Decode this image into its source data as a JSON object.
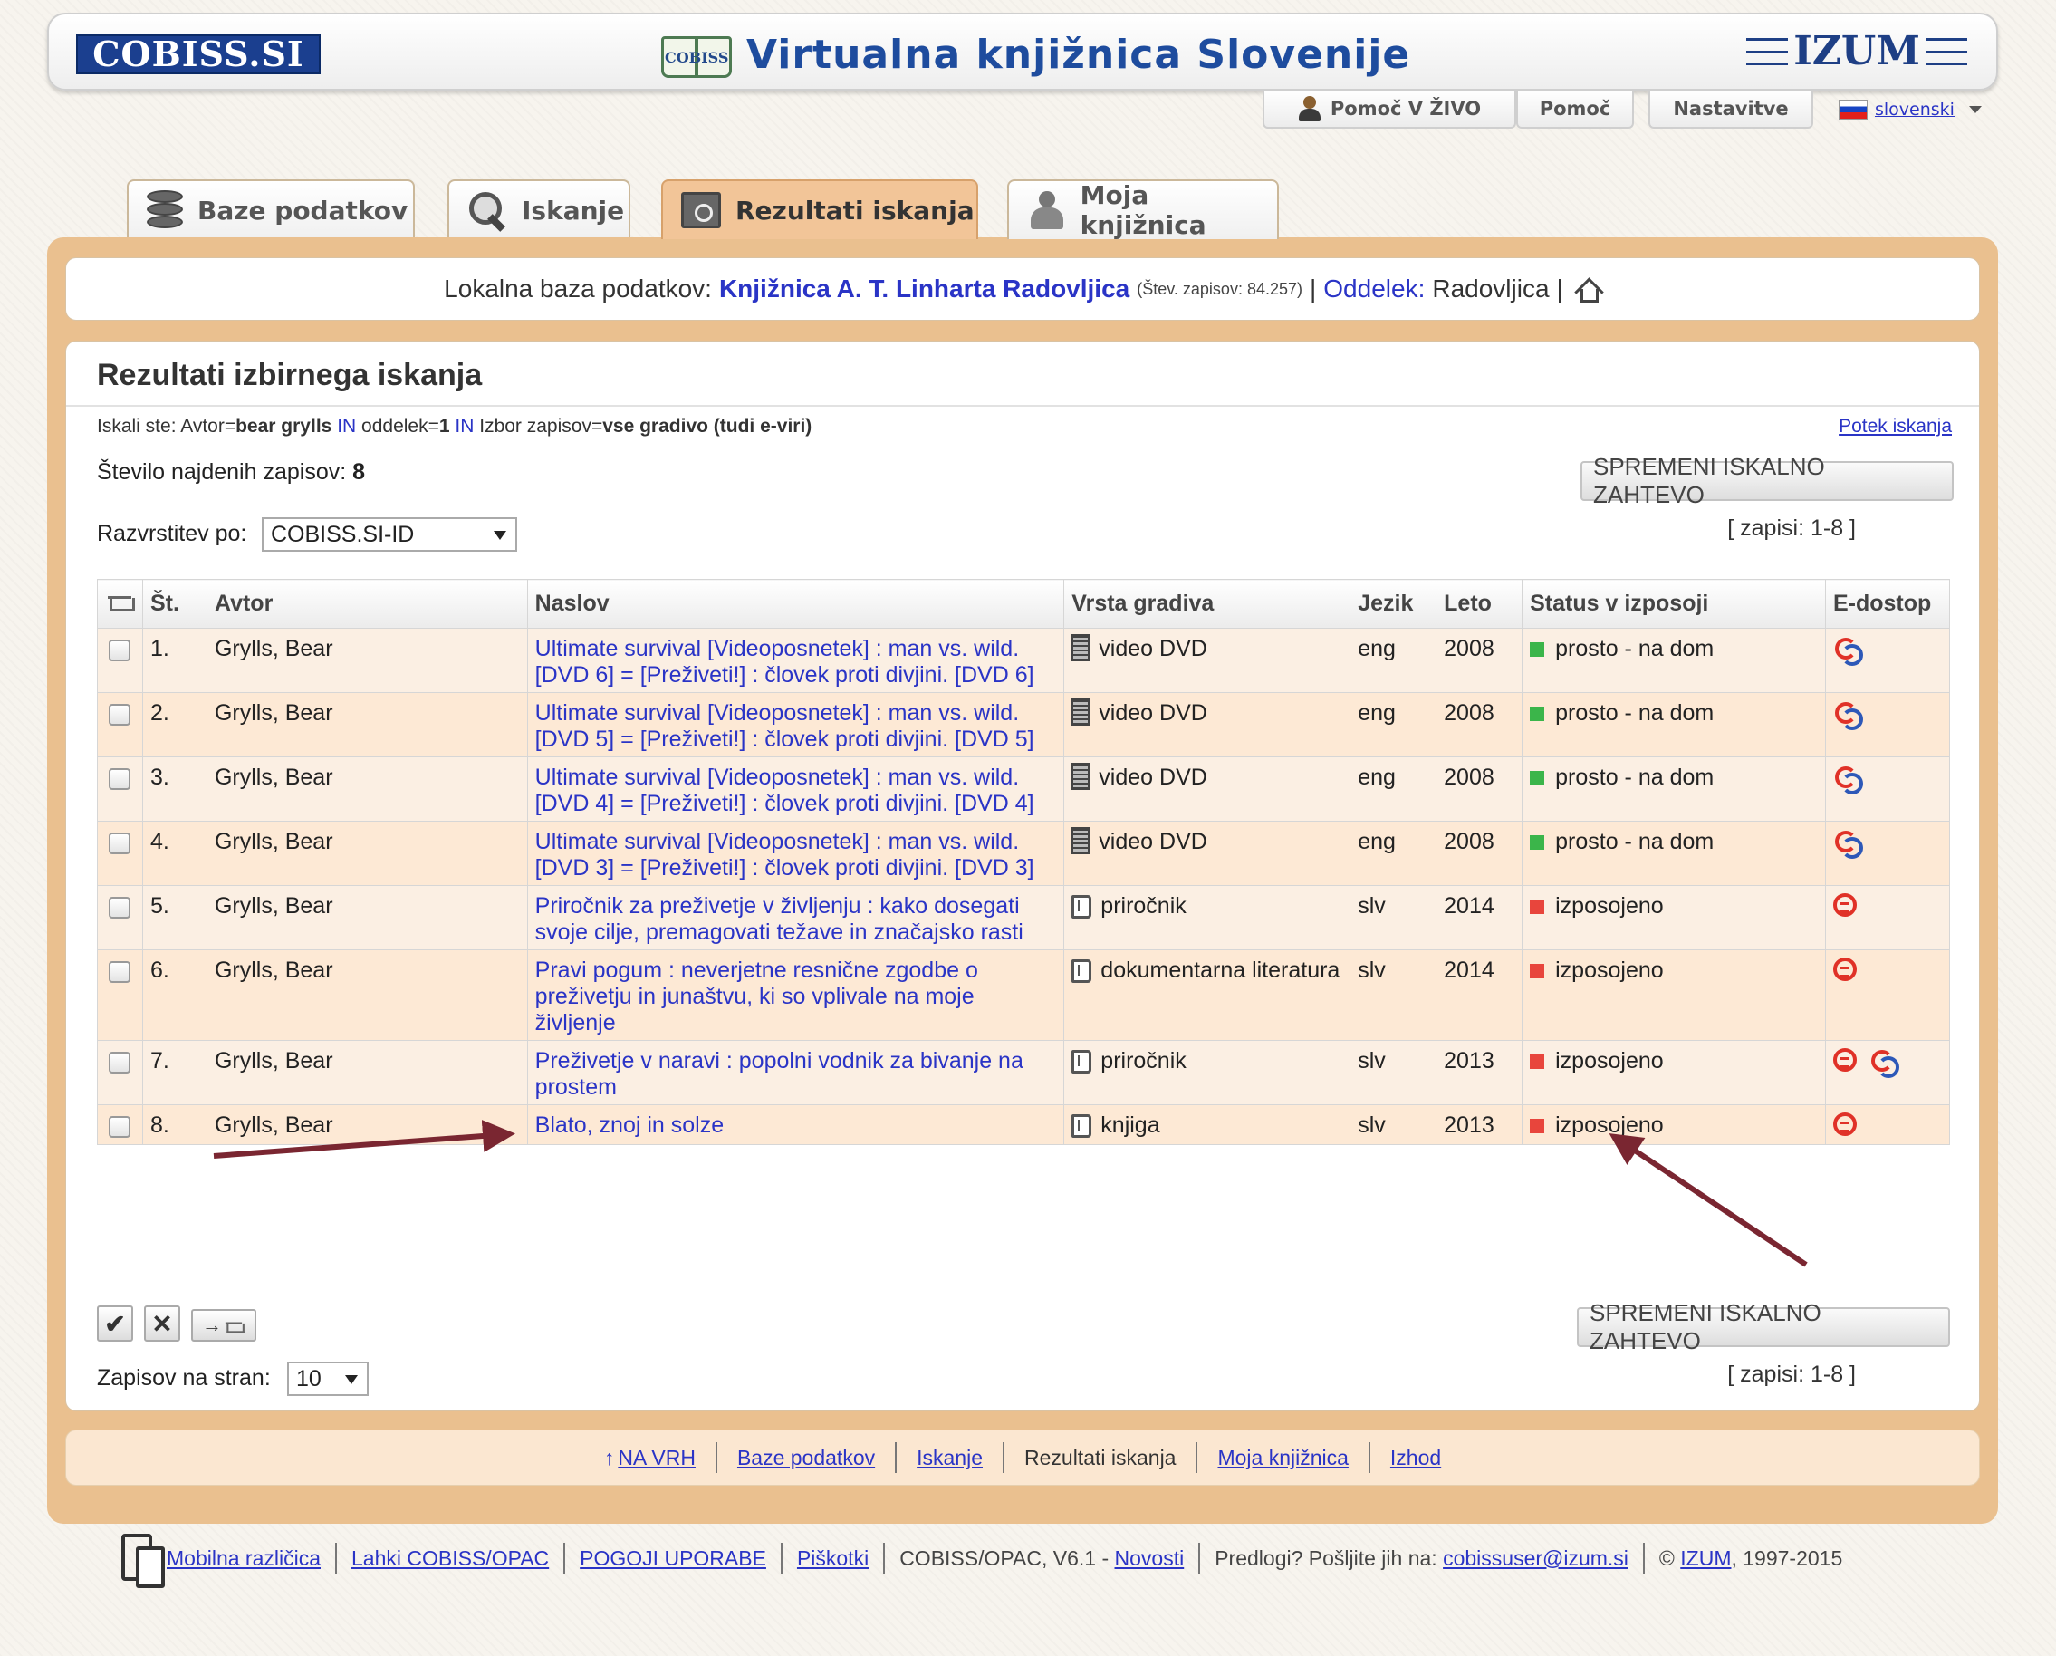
{
  "header": {
    "logo_left": "COBISS.SI",
    "logo_book_text": "COBISS",
    "title": "Virtualna knjižnica Slovenije",
    "logo_right": "IZUM"
  },
  "topbar": {
    "live_help": "Pomoč V ŽIVO",
    "help": "Pomoč",
    "settings": "Nastavitve",
    "language": "slovenski"
  },
  "tabs": [
    {
      "label": "Baze podatkov",
      "icon": "database-icon"
    },
    {
      "label": "Iskanje",
      "icon": "magnifier-icon"
    },
    {
      "label": "Rezultati iskanja",
      "icon": "folder-icon",
      "active": true
    },
    {
      "label": "Moja knjižnica",
      "icon": "users-icon"
    }
  ],
  "dbinfo": {
    "prefix": "Lokalna baza podatkov:",
    "library": "Knjižnica A. T. Linharta Radovljica",
    "records": "(Štev. zapisov: 84.257)",
    "sep1": "|",
    "dept_label": "Oddelek:",
    "dept_value": "Radovljica",
    "sep2": "|"
  },
  "results": {
    "title": "Rezultati izbirnega iskanja",
    "query_prefix": "Iskali ste: Avtor=",
    "query_author": "bear grylls",
    "query_in1": "IN",
    "query_mid1": "oddelek=",
    "query_dept": "1",
    "query_in2": "IN",
    "query_mid2": "Izbor zapisov=",
    "query_scope": "vse gradivo (tudi e-viri)",
    "history_link": "Potek iskanja",
    "count_label": "Število najdenih zapisov:",
    "count_value": "8",
    "modify_button": "SPREMENI ISKALNO ZAHTEVO",
    "sort_label": "Razvrstitev po:",
    "sort_value": "COBISS.SI-ID",
    "range": "[ zapisi: 1-8 ]",
    "per_page_label": "Zapisov na stran:",
    "per_page_value": "10"
  },
  "table": {
    "headers": [
      "Št.",
      "Avtor",
      "Naslov",
      "Vrsta gradiva",
      "Jezik",
      "Leto",
      "Status v izposoji",
      "E-dostop"
    ],
    "rows": [
      {
        "no": "1.",
        "author": "Grylls, Bear",
        "title": "Ultimate survival [Videoposnetek] : man vs. wild. [DVD 6] = [Preživeti!] : človek proti divjini. [DVD 6]",
        "type": "video DVD",
        "type_icon": "dvd-icon",
        "lang": "eng",
        "year": "2008",
        "status": "prosto - na dom",
        "status_color": "#3bb54a",
        "eaccess": [
          "cobiss-share-icon"
        ]
      },
      {
        "no": "2.",
        "author": "Grylls, Bear",
        "title": "Ultimate survival [Videoposnetek] : man vs. wild. [DVD 5] = [Preživeti!] : človek proti divjini. [DVD 5]",
        "type": "video DVD",
        "type_icon": "dvd-icon",
        "lang": "eng",
        "year": "2008",
        "status": "prosto - na dom",
        "status_color": "#3bb54a",
        "eaccess": [
          "cobiss-share-icon"
        ]
      },
      {
        "no": "3.",
        "author": "Grylls, Bear",
        "title": "Ultimate survival [Videoposnetek] : man vs. wild. [DVD 4] = [Preživeti!] : človek proti divjini. [DVD 4]",
        "type": "video DVD",
        "type_icon": "dvd-icon",
        "lang": "eng",
        "year": "2008",
        "status": "prosto - na dom",
        "status_color": "#3bb54a",
        "eaccess": [
          "cobiss-share-icon"
        ]
      },
      {
        "no": "4.",
        "author": "Grylls, Bear",
        "title": "Ultimate survival [Videoposnetek] : man vs. wild. [DVD 3] = [Preživeti!] : človek proti divjini. [DVD 3]",
        "type": "video DVD",
        "type_icon": "dvd-icon",
        "lang": "eng",
        "year": "2008",
        "status": "prosto - na dom",
        "status_color": "#3bb54a",
        "eaccess": [
          "cobiss-share-icon"
        ]
      },
      {
        "no": "5.",
        "author": "Grylls, Bear",
        "title": "Priročnik za preživetje v življenju : kako dosegati svoje cilje, premagovati težave in značajsko rasti",
        "type": "priročnik",
        "type_icon": "book-icon",
        "lang": "slv",
        "year": "2014",
        "status": "izposojeno",
        "status_color": "#e8453c",
        "eaccess": [
          "reservation-icon"
        ]
      },
      {
        "no": "6.",
        "author": "Grylls, Bear",
        "title": "Pravi pogum : neverjetne resnične zgodbe o preživetju in junaštvu, ki so vplivale na moje življenje",
        "type": "dokumentarna literatura",
        "type_icon": "book-icon",
        "lang": "slv",
        "year": "2014",
        "status": "izposojeno",
        "status_color": "#e8453c",
        "eaccess": [
          "reservation-icon"
        ]
      },
      {
        "no": "7.",
        "author": "Grylls, Bear",
        "title": "Preživetje v naravi : popolni vodnik za bivanje na prostem",
        "type": "priročnik",
        "type_icon": "book-icon",
        "lang": "slv",
        "year": "2013",
        "status": "izposojeno",
        "status_color": "#e8453c",
        "eaccess": [
          "reservation-icon",
          "cobiss-share-icon"
        ]
      },
      {
        "no": "8.",
        "author": "Grylls, Bear",
        "title": "Blato, znoj in solze",
        "type": "knjiga",
        "type_icon": "book-icon",
        "lang": "slv",
        "year": "2013",
        "status": "izposojeno",
        "status_color": "#e8453c",
        "eaccess": [
          "reservation-icon"
        ]
      }
    ]
  },
  "actions": {
    "check": "✔",
    "clear": "✕",
    "to_basket": "→"
  },
  "bottom_nav": {
    "top": "NA VRH",
    "items": [
      "Baze podatkov",
      "Iskanje",
      "Rezultati iskanja",
      "Moja knjižnica",
      "Izhod"
    ]
  },
  "footer": {
    "mobile": "Mobilna različica",
    "light": "Lahki COBISS/OPAC",
    "terms": "POGOJI UPORABE",
    "cookies": "Piškotki",
    "version_prefix": "COBISS/OPAC, V6.1 -",
    "news": "Novosti",
    "suggest_prefix": "Predlogi? Pošljite jih na:",
    "email": "cobissuser@izum.si",
    "copy_prefix": "©",
    "izum": "IZUM",
    "years": ", 1997-2015"
  },
  "annotation_color": "#7a2631"
}
